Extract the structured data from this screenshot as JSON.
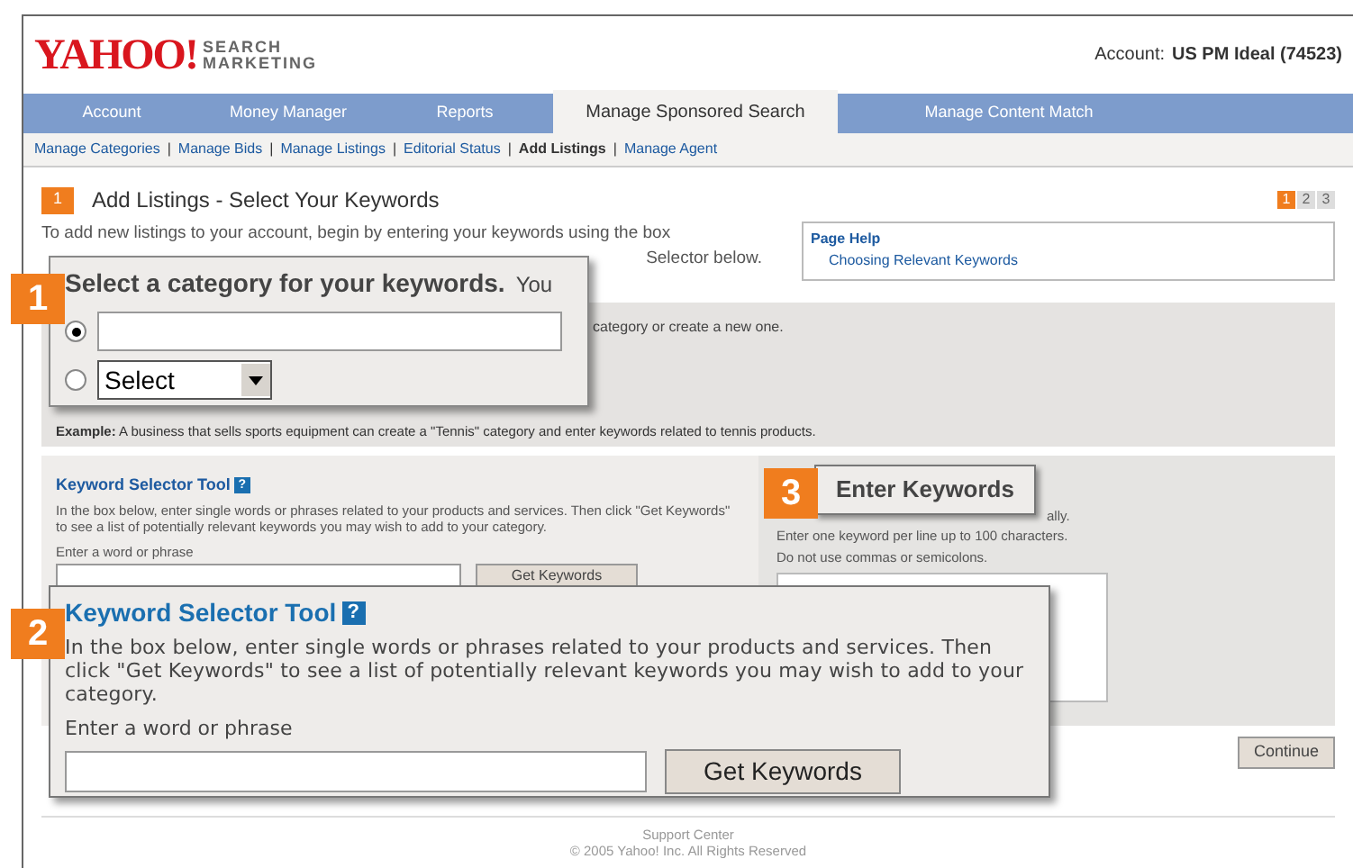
{
  "header": {
    "logo": "YAHOO!",
    "logo_sub": [
      "SEARCH",
      "MARKETING"
    ],
    "account_label": "Account:",
    "account_name": "US PM Ideal (74523)"
  },
  "tabs": [
    {
      "label": "Account",
      "selected": false
    },
    {
      "label": "Money Manager",
      "selected": false
    },
    {
      "label": "Reports",
      "selected": false
    },
    {
      "label": "Manage Sponsored Search",
      "selected": true
    },
    {
      "label": "Manage Content Match",
      "selected": false
    }
  ],
  "subnav_separator": "|",
  "subnav": [
    {
      "label": "Manage Categories",
      "selected": false
    },
    {
      "label": "Manage Bids",
      "selected": false
    },
    {
      "label": "Manage Listings",
      "selected": false
    },
    {
      "label": "Editorial Status",
      "selected": false
    },
    {
      "label": "Add Listings",
      "selected": true
    },
    {
      "label": "Manage Agent",
      "selected": false
    }
  ],
  "page": {
    "step": "1",
    "title": "Add Listings - Select Your Keywords",
    "steps": [
      {
        "label": "1",
        "selected": true
      },
      {
        "label": "2",
        "selected": false
      },
      {
        "label": "3",
        "selected": false
      }
    ],
    "intro": "To add new listings to your account, begin by entering your keywords using the box",
    "intro_tail": "Selector below.",
    "help": {
      "title": "Page Help",
      "link": "Choosing Relevant Keywords"
    }
  },
  "category_panel": {
    "fragment": "category or create a new one.",
    "example_label": "Example:",
    "example_text": "A business that sells sports equipment can create a \"Tennis\" category and enter keywords related to tennis products."
  },
  "keyword_tool": {
    "title": "Keyword Selector Tool",
    "help": "?",
    "description": "In the box below, enter single words or phrases related to your products and services. Then click \"Get Keywords\" to see a list of potentially relevant keywords you may wish to add to your category.",
    "field_label": "Enter a word or phrase",
    "button": "Get Keywords"
  },
  "enter_keywords": {
    "fragment": "ally.",
    "lines": [
      "Enter one keyword per line up to 100 characters.",
      "Do not use commas or semicolons."
    ]
  },
  "continue_button": "Continue",
  "footer": {
    "support": "Support Center",
    "copyright": "© 2005 Yahoo! Inc. All Rights Reserved"
  },
  "callouts": [
    {
      "number": "1",
      "kind": "category",
      "title": "Select a category for your keywords.",
      "trailing": "You",
      "radios": [
        {
          "kind": "text",
          "selected": true
        },
        {
          "kind": "select",
          "selected": false,
          "value": "Select"
        }
      ]
    },
    {
      "number": "3",
      "kind": "heading",
      "title": "Enter Keywords"
    },
    {
      "number": "2",
      "kind": "keyword_tool",
      "title": "Keyword Selector Tool",
      "help": "?",
      "description": "In the box below, enter single words or phrases related to your products and services. Then click \"Get Keywords\" to see a list of potentially relevant keywords you may wish to add to your category.",
      "field_label": "Enter a word or phrase",
      "button": "Get Keywords"
    }
  ]
}
